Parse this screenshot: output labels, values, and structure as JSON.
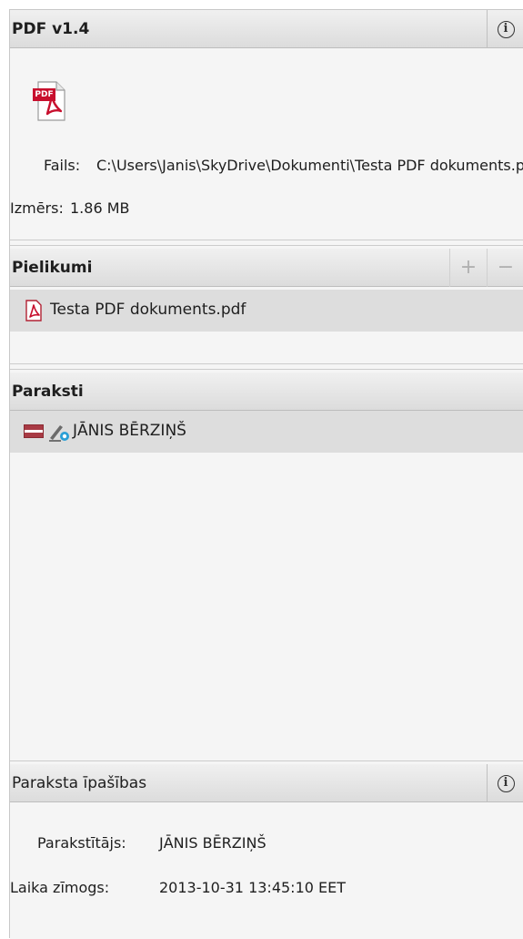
{
  "file_panel": {
    "title": "PDF v1.4",
    "file_label": "Fails:",
    "file_path": "C:\\Users\\Janis\\SkyDrive\\Dokumenti\\Testa PDF dokuments.pdf",
    "size_label": "Izmērs:",
    "size_value": "1.86 MB",
    "pdf_icon_text": "PDF"
  },
  "attachments_panel": {
    "title": "Pielikumi",
    "add_label": "+",
    "remove_label": "−",
    "items": [
      {
        "name": "Testa PDF dokuments.pdf"
      }
    ]
  },
  "signatures_panel": {
    "title": "Paraksti",
    "items": [
      {
        "signer": "JĀNIS BĒRZIŅŠ"
      }
    ]
  },
  "properties_panel": {
    "title": "Paraksta īpašības",
    "signer_label": "Parakstītājs:",
    "signer_value": "JĀNIS BĒRZIŅŠ",
    "timestamp_label": "Laika zīmogs:",
    "timestamp_value": "2013-10-31 13:45:10 EET"
  },
  "info_symbol": "i",
  "colors": {
    "header_gradient_top": "#f0f0f0",
    "header_gradient_bottom": "#dcdcdc",
    "selected_row": "#dddddd",
    "pdf_red": "#c8102e",
    "flag_red": "#9e3039"
  }
}
